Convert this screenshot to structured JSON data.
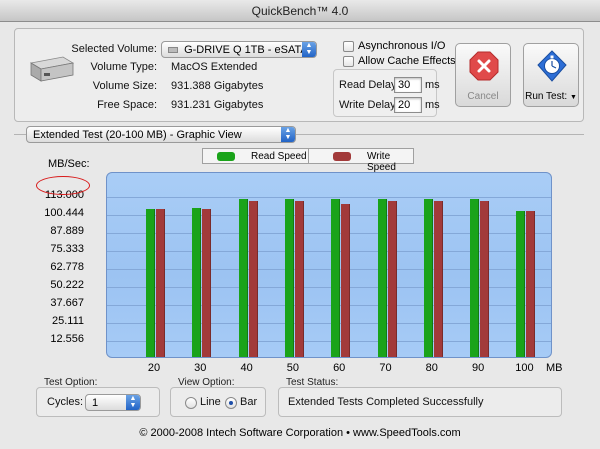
{
  "window": {
    "title": "QuickBench™ 4.0"
  },
  "volume": {
    "selected_label": "Selected Volume:",
    "selected_value": "G-DRIVE Q 1TB - eSATA",
    "type_label": "Volume Type:",
    "type_value": "MacOS Extended",
    "size_label": "Volume Size:",
    "size_value": "931.388 Gigabytes",
    "free_label": "Free Space:",
    "free_value": "931.231 Gigabytes"
  },
  "options": {
    "async_label": "Asynchronous I/O",
    "async_checked": false,
    "cache_label": "Allow Cache Effects",
    "cache_checked": false,
    "read_delay_label": "Read Delay:",
    "read_delay_value": "30",
    "read_delay_unit": "ms",
    "write_delay_label": "Write Delay:",
    "write_delay_value": "20",
    "write_delay_unit": "ms"
  },
  "buttons": {
    "cancel_label": "Cancel",
    "run_label": "Run Test:"
  },
  "view_menu": {
    "selected": "Extended Test (20-100 MB) - Graphic View"
  },
  "colors": {
    "read": "#1aa31a",
    "write": "#a23a3a",
    "highlight": "#d81b1b"
  },
  "chart_data": {
    "type": "bar",
    "ylabel": "MB/Sec:",
    "xlabel": "MB",
    "y_ticks": [
      "113.000",
      "100.444",
      "87.889",
      "75.333",
      "62.778",
      "50.222",
      "37.667",
      "25.111",
      "12.556"
    ],
    "ylim": [
      0,
      113
    ],
    "categories": [
      "20",
      "30",
      "40",
      "50",
      "60",
      "70",
      "80",
      "90",
      "100"
    ],
    "series": [
      {
        "name": "Read Speed",
        "values": [
          103,
          104,
          110,
          110,
          110,
          110,
          110,
          110,
          102
        ]
      },
      {
        "name": "Write Speed",
        "values": [
          103,
          103,
          109,
          109,
          107,
          109,
          109,
          109,
          102
        ]
      }
    ],
    "annotation": "113.000",
    "legend_position": "top-center",
    "grid": true
  },
  "test_option": {
    "label": "Test Option:",
    "cycles_label": "Cycles:",
    "cycles_value": "1"
  },
  "view_option": {
    "label": "View Option:",
    "line_label": "Line",
    "bar_label": "Bar",
    "selected": "Bar"
  },
  "test_status": {
    "label": "Test Status:",
    "value": "Extended Tests Completed Successfully"
  },
  "footer": {
    "text": "© 2000-2008 Intech Software Corporation • www.SpeedTools.com"
  }
}
